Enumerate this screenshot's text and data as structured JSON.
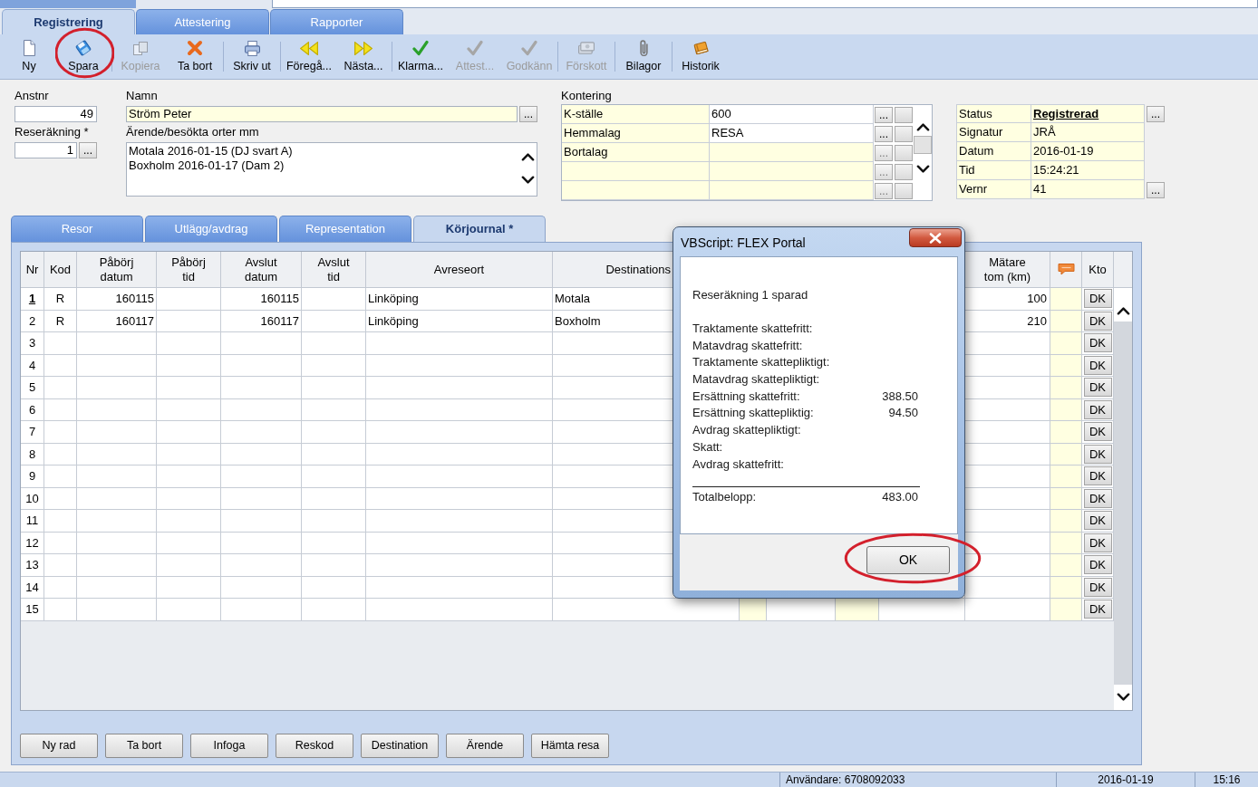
{
  "top_tabs": [
    {
      "label": "Registrering",
      "selected": true
    },
    {
      "label": "Attestering",
      "selected": false
    },
    {
      "label": "Rapporter",
      "selected": false
    }
  ],
  "toolbar": {
    "groups": [
      {
        "items": [
          {
            "kind": "new",
            "label": "Ny",
            "disabled": false,
            "circled": false
          },
          {
            "kind": "save",
            "label": "Spara",
            "disabled": false,
            "circled": true
          }
        ]
      },
      {
        "items": [
          {
            "kind": "copy",
            "label": "Kopiera",
            "disabled": true,
            "circled": false
          },
          {
            "kind": "delete",
            "label": "Ta bort",
            "disabled": false,
            "circled": false
          }
        ]
      },
      {
        "items": [
          {
            "kind": "print",
            "label": "Skriv ut",
            "disabled": false,
            "circled": false
          }
        ]
      },
      {
        "items": [
          {
            "kind": "previous",
            "label": "Föregå...",
            "disabled": false,
            "circled": false
          },
          {
            "kind": "next",
            "label": "Nästa...",
            "disabled": false,
            "circled": false
          }
        ]
      },
      {
        "items": [
          {
            "kind": "check",
            "label": "Klarma...",
            "disabled": false,
            "circled": false
          },
          {
            "kind": "check",
            "label": "Attest...",
            "disabled": true,
            "circled": false
          },
          {
            "kind": "check",
            "label": "Godkänn",
            "disabled": true,
            "circled": false
          }
        ]
      },
      {
        "items": [
          {
            "kind": "money",
            "label": "Förskott",
            "disabled": true,
            "circled": false
          }
        ]
      },
      {
        "items": [
          {
            "kind": "attachment",
            "label": "Bilagor",
            "disabled": false,
            "circled": false
          }
        ]
      },
      {
        "items": [
          {
            "kind": "history",
            "label": "Historik",
            "disabled": false,
            "circled": false
          }
        ]
      }
    ]
  },
  "header_form": {
    "employee_number": {
      "label": "Anstnr",
      "value": "49"
    },
    "expense_report": {
      "label": "Reseräkning *",
      "value": "1",
      "lookup": "..."
    },
    "name": {
      "label": "Namn",
      "value": "Ström Peter",
      "lookup": "..."
    },
    "errand": {
      "label": "Ärende/besökta orter mm",
      "lines": [
        "Motala 2016-01-15 (DJ svart A)",
        "Boxholm 2016-01-17 (Dam 2)"
      ]
    },
    "kontering": {
      "label": "Kontering",
      "rows": [
        {
          "label": "K-ställe",
          "value": "600",
          "lookup": "...",
          "disabled": false
        },
        {
          "label": "Hemmalag",
          "value": "RESA",
          "lookup": "...",
          "disabled": false
        },
        {
          "label": "Bortalag",
          "lookup": "...",
          "disabled": true
        },
        {
          "lookup": "...",
          "disabled": true
        },
        {
          "lookup": "...",
          "disabled": true
        }
      ]
    },
    "status_panel": {
      "rows": [
        {
          "label": "Status",
          "value": "Registrerad",
          "emphasized": true,
          "lookup": "..."
        },
        {
          "label": "Signatur",
          "value": "JRÅ",
          "emphasized": false
        },
        {
          "label": "Datum",
          "value": "2016-01-19",
          "emphasized": false
        },
        {
          "label": "Tid",
          "value": "15:24:21",
          "emphasized": false
        },
        {
          "label": "Vernr",
          "value": "41",
          "emphasized": false,
          "lookup": "..."
        }
      ]
    }
  },
  "sub_tabs": [
    {
      "label": "Resor",
      "selected": false
    },
    {
      "label": "Utlägg/avdrag",
      "selected": false
    },
    {
      "label": "Representation",
      "selected": false
    },
    {
      "label": "Körjournal *",
      "selected": true
    }
  ],
  "table": {
    "columns": [
      {
        "header": "Nr",
        "kind": "text"
      },
      {
        "header": "Kod",
        "kind": "text"
      },
      {
        "header": "Påbörj\ndatum",
        "kind": "text"
      },
      {
        "header": "Påbörj\ntid",
        "kind": "text"
      },
      {
        "header": "Avslut\ndatum",
        "kind": "text"
      },
      {
        "header": "Avslut\ntid",
        "kind": "text"
      },
      {
        "header": "Avreseort",
        "kind": "text"
      },
      {
        "header": "Destinations",
        "kind": "text"
      },
      {
        "kind": "entry"
      },
      {
        "kind": "text"
      },
      {
        "kind": "entry"
      },
      {
        "kind": "text"
      },
      {
        "header": "Mätare\ntom (km)",
        "kind": "text"
      },
      {
        "kind": "note"
      },
      {
        "header": "Kto",
        "kind": "button"
      }
    ],
    "rows": [
      {
        "selected": true,
        "cells": {
          "nr": "1",
          "kod": "R",
          "start_date": "160115",
          "end_date": "160115",
          "origin": "Linköping",
          "destination": "Motala",
          "odometer_end": "100",
          "account": "DK"
        }
      },
      {
        "selected": false,
        "cells": {
          "nr": "2",
          "kod": "R",
          "start_date": "160117",
          "end_date": "160117",
          "origin": "Linköping",
          "destination": "Boxholm",
          "odometer_end": "210",
          "account": "DK"
        }
      },
      {
        "selected": false,
        "cells": {
          "nr": "3",
          "account": "DK"
        }
      },
      {
        "selected": false,
        "cells": {
          "nr": "4",
          "account": "DK"
        }
      },
      {
        "selected": false,
        "cells": {
          "nr": "5",
          "account": "DK"
        }
      },
      {
        "selected": false,
        "cells": {
          "nr": "6",
          "account": "DK"
        }
      },
      {
        "selected": false,
        "cells": {
          "nr": "7",
          "account": "DK"
        }
      },
      {
        "selected": false,
        "cells": {
          "nr": "8",
          "account": "DK"
        }
      },
      {
        "selected": false,
        "cells": {
          "nr": "9",
          "account": "DK"
        }
      },
      {
        "selected": false,
        "cells": {
          "nr": "10",
          "account": "DK"
        }
      },
      {
        "selected": false,
        "cells": {
          "nr": "11",
          "account": "DK"
        }
      },
      {
        "selected": false,
        "cells": {
          "nr": "12",
          "account": "DK"
        }
      },
      {
        "selected": false,
        "cells": {
          "nr": "13",
          "account": "DK"
        }
      },
      {
        "selected": false,
        "cells": {
          "nr": "14",
          "account": "DK"
        }
      },
      {
        "selected": false,
        "cells": {
          "nr": "15",
          "account": "DK"
        }
      }
    ]
  },
  "buttons": [
    "Ny rad",
    "Ta bort",
    "Infoga",
    "Reskod",
    "Destination",
    "Ärende",
    "Hämta resa"
  ],
  "status_bar": {
    "user": "Användare: 6708092033",
    "date": "2016-01-19",
    "time": "15:16"
  },
  "dialog": {
    "title": "VBScript: FLEX Portal",
    "message": "Reseräkning 1 sparad",
    "lines": [
      {
        "label": "Traktamente skattefritt:"
      },
      {
        "label": "Matavdrag skattefritt:"
      },
      {
        "label": "Traktamente skattepliktigt:"
      },
      {
        "label": "Matavdrag skattepliktigt:"
      },
      {
        "label": "Ersättning skattefritt:",
        "value": "388.50"
      },
      {
        "label": "Ersättning skattepliktig:",
        "value": "94.50"
      },
      {
        "label": "Avdrag skattepliktigt:"
      },
      {
        "label": "Skatt:"
      },
      {
        "label": "Avdrag skattefritt:"
      }
    ],
    "total": {
      "label": "Totalbelopp:",
      "value": "483.00"
    },
    "button": {
      "label": "OK",
      "circled": true
    }
  }
}
